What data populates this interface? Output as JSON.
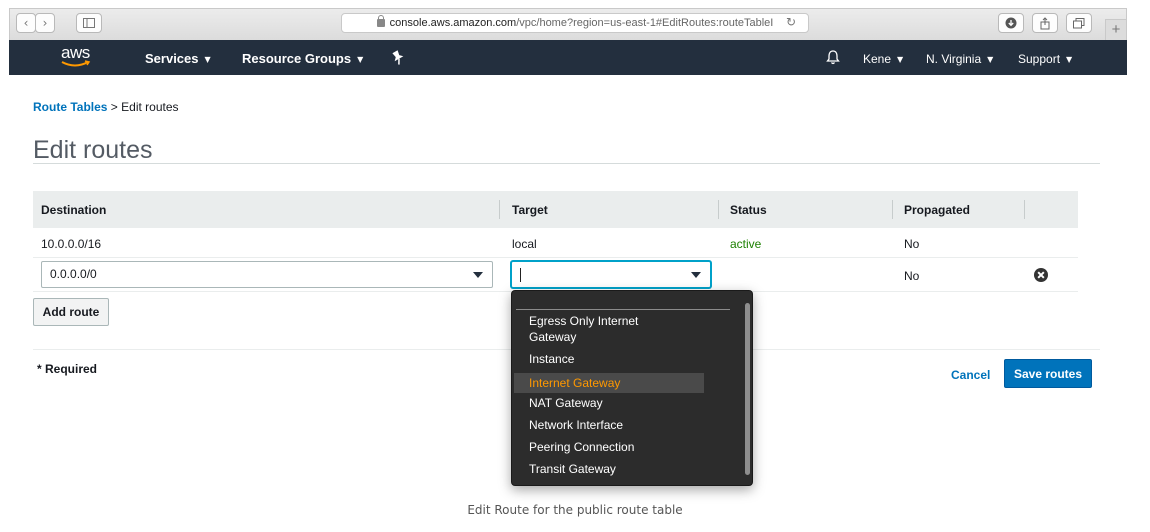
{
  "browser": {
    "back": "‹",
    "forward": "›",
    "url_host": "console.aws.amazon.com",
    "url_path": "/vpc/home?region=us-east-1#EditRoutes:routeTableI",
    "new_tab": "+"
  },
  "nav": {
    "logo": "aws",
    "services": "Services",
    "resource_groups": "Resource Groups",
    "user": "Kene",
    "region": "N. Virginia",
    "support": "Support"
  },
  "breadcrumb": {
    "parent": "Route Tables",
    "separator": " > ",
    "current": "Edit routes"
  },
  "page_title": "Edit routes",
  "table": {
    "columns": [
      "Destination",
      "Target",
      "Status",
      "Propagated"
    ],
    "row1": {
      "destination": "10.0.0.0/16",
      "target": "local",
      "status": "active",
      "propagated": "No"
    },
    "row2": {
      "destination": "0.0.0.0/0",
      "target": "",
      "propagated": "No"
    }
  },
  "buttons": {
    "add_route": "Add route",
    "cancel": "Cancel",
    "save_routes": "Save routes"
  },
  "required_note": "* Required",
  "dropdown": {
    "items": [
      "Egress Only Internet",
      "Gateway",
      "Instance",
      "Internet Gateway",
      "NAT Gateway",
      "Network Interface",
      "Peering Connection",
      "Transit Gateway"
    ],
    "highlighted": "Internet Gateway"
  },
  "caption": "Edit Route for the public route table",
  "colors": {
    "nav_bg": "#232f3e",
    "link": "#0073bb",
    "active": "#1d8102",
    "highlight": "#ff9900"
  }
}
